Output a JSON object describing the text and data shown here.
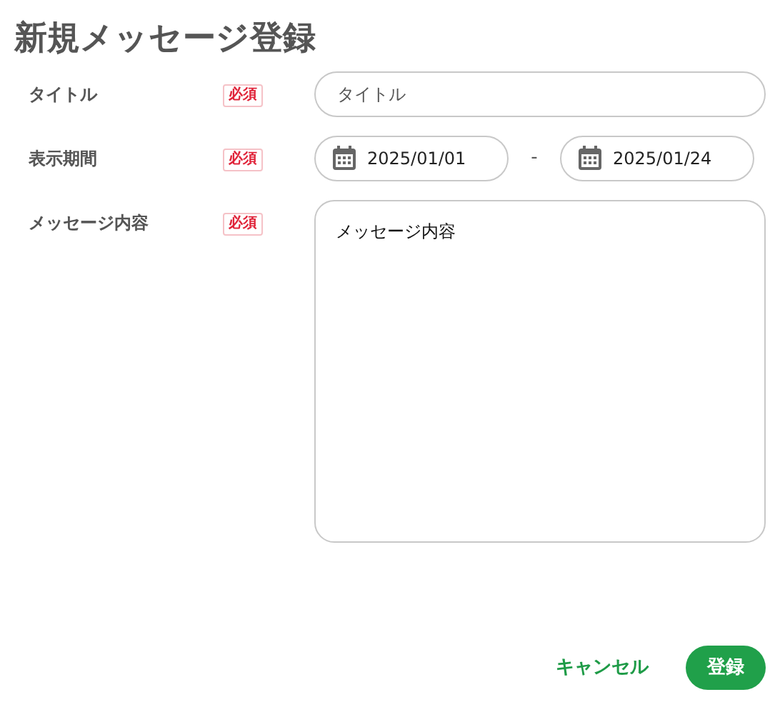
{
  "heading": "新規メッセージ登録",
  "fields": [
    {
      "kind": "text",
      "label": "タイトル",
      "required_badge": "必須",
      "placeholder": "タイトル"
    },
    {
      "kind": "daterange",
      "label": "表示期間",
      "required_badge": "必須",
      "start": "2025/01/01",
      "separator": "-",
      "end": "2025/01/24"
    },
    {
      "kind": "textarea",
      "label": "メッセージ内容",
      "required_badge": "必須",
      "value": "メッセージ内容"
    }
  ],
  "buttons": [
    {
      "kind": "link",
      "label": "キャンセル"
    },
    {
      "kind": "primary",
      "label": "登録"
    }
  ]
}
